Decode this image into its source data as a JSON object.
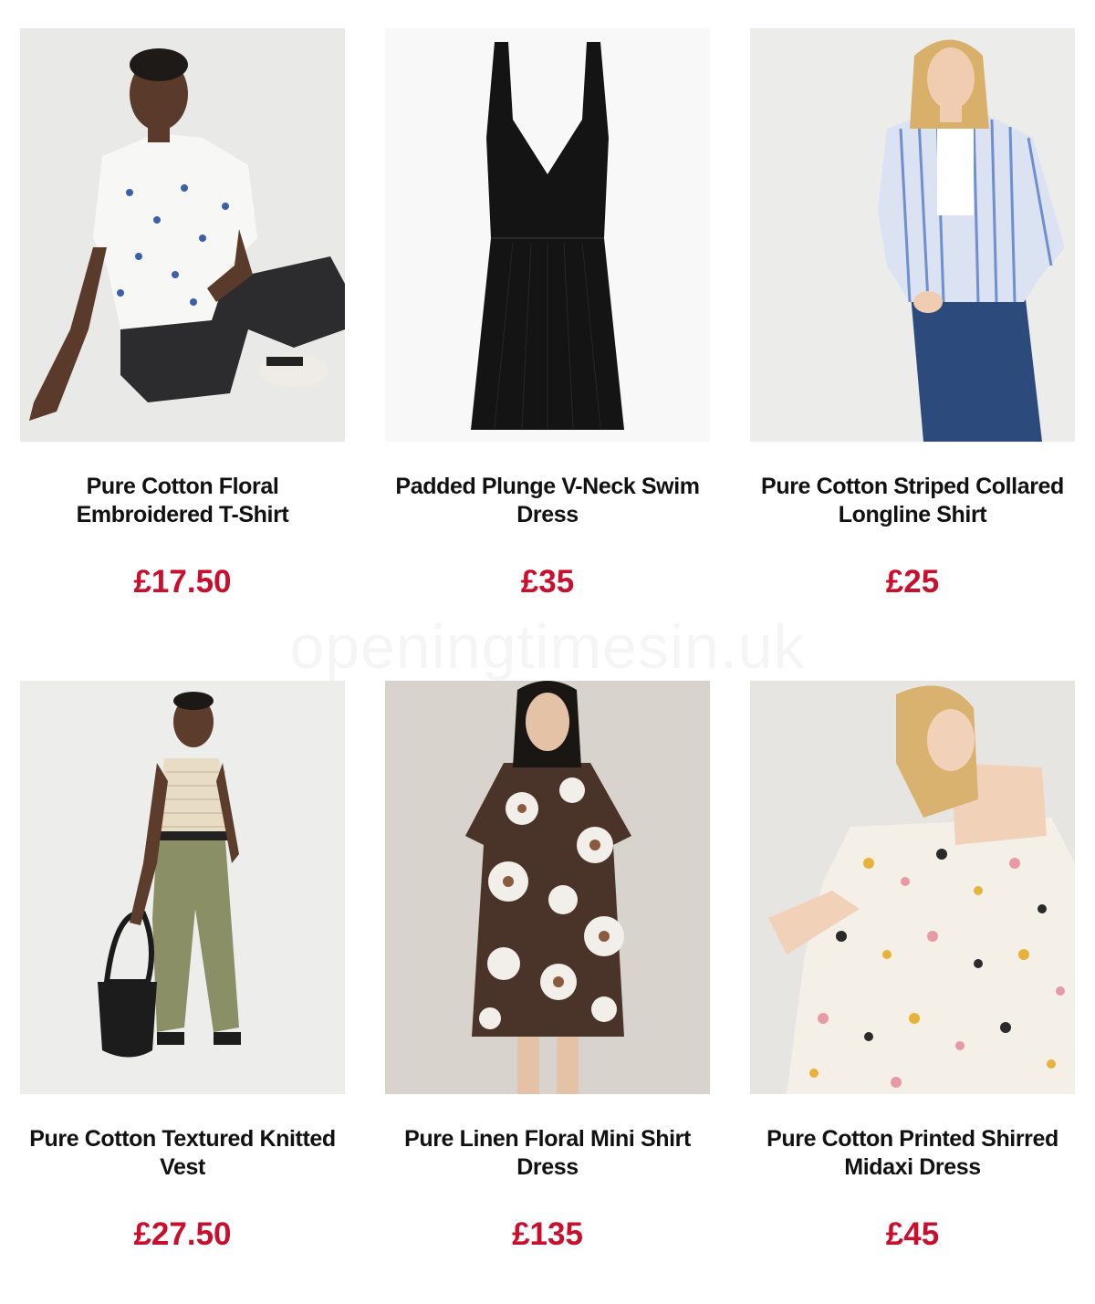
{
  "products": [
    {
      "title": "Pure Cotton Floral Embroidered T-Shirt",
      "price": "£17.50",
      "image_icon": "woman-white-tshirt-jeans-photo"
    },
    {
      "title": "Padded Plunge V-Neck Swim Dress",
      "price": "£35",
      "image_icon": "black-swim-dress-photo"
    },
    {
      "title": "Pure Cotton Striped Collared Longline Shirt",
      "price": "£25",
      "image_icon": "woman-striped-shirt-photo"
    },
    {
      "title": "Pure Cotton Textured Knitted Vest",
      "price": "£27.50",
      "image_icon": "woman-knitted-vest-khaki-trousers-photo"
    },
    {
      "title": "Pure Linen Floral Mini Shirt Dress",
      "price": "£135",
      "image_icon": "woman-floral-shirt-dress-photo"
    },
    {
      "title": "Pure Cotton Printed Shirred Midaxi Dress",
      "price": "£45",
      "image_icon": "woman-printed-midaxi-dress-photo"
    }
  ],
  "watermark": "openingtimesin.uk",
  "colors": {
    "price": "#c8102e",
    "title": "#111111",
    "background": "#ffffff"
  }
}
